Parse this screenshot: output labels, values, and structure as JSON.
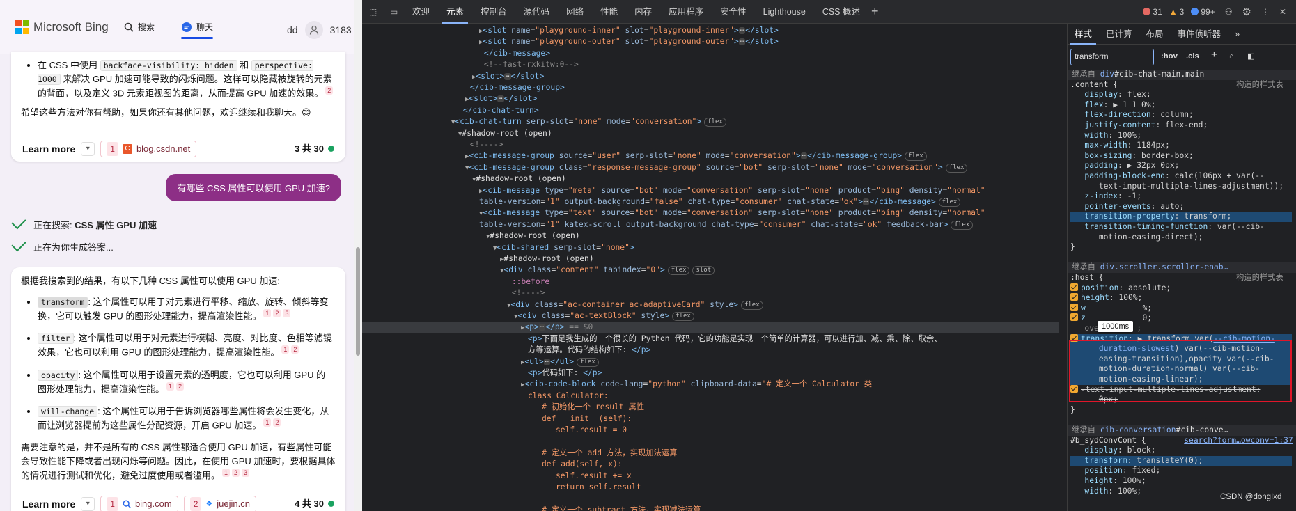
{
  "bing": {
    "brand": "Microsoft Bing",
    "nav": {
      "search": "搜索",
      "chat": "聊天"
    },
    "user": {
      "name": "dd",
      "points": "3183"
    },
    "card1": {
      "li_pre": "在 CSS 中使用",
      "code1": "backface-visibility: hidden",
      "and": "和",
      "code2": "perspective: 1000",
      "li_post": "来解决 GPU 加速可能导致的闪烁问题。这样可以隐藏被旋转的元素的背面，以及定义 3D 元素距视图的距离，从而提高 GPU 加速的效果。",
      "li_cite": "2",
      "closing": "希望这些方法对你有帮助，如果你还有其他问题，欢迎继续和我聊天。😊",
      "learn_more": "Learn more",
      "source1_num": "1",
      "source1": "blog.csdn.net",
      "count": "3 共 30"
    },
    "user_question": "有哪些 CSS 属性可以使用 GPU 加速?",
    "progress1_pre": "正在搜索: ",
    "progress1_bold": "CSS 属性 GPU 加速",
    "progress2": "正在为你生成答案...",
    "card2": {
      "intro": "根据我搜索到的结果，有以下几种 CSS 属性可以使用 GPU 加速:",
      "items": [
        {
          "code": "transform",
          "text": ": 这个属性可以用于对元素进行平移、缩放、旋转、倾斜等变换，它可以触发 GPU 的图形处理能力，提高渲染性能。",
          "cites": [
            "1",
            "2",
            "3"
          ]
        },
        {
          "code": "filter",
          "text": ": 这个属性可以用于对元素进行模糊、亮度、对比度、色相等滤镜效果，它也可以利用 GPU 的图形处理能力，提高渲染性能。",
          "cites": [
            "1",
            "2"
          ]
        },
        {
          "code": "opacity",
          "text": ": 这个属性可以用于设置元素的透明度，它也可以利用 GPU 的图形处理能力，提高渲染性能。",
          "cites": [
            "1",
            "2"
          ]
        },
        {
          "code": "will-change",
          "text": ": 这个属性可以用于告诉浏览器哪些属性将会发生变化，从而让浏览器提前为这些属性分配资源，开启 GPU 加速。",
          "cites": [
            "1",
            "2"
          ]
        }
      ],
      "note": "需要注意的是，并不是所有的 CSS 属性都适合使用 GPU 加速，有些属性可能会导致性能下降或者出现闪烁等问题。因此，在使用 GPU 加速时，要根据具体的情况进行测试和优化，避免过度使用或者滥用。",
      "note_cites": [
        "1",
        "2",
        "3"
      ],
      "learn_more": "Learn more",
      "source1_num": "1",
      "source1": "bing.com",
      "source2_num": "2",
      "source2": "juejin.cn",
      "count": "4 共 30"
    }
  },
  "devtools": {
    "tabs": [
      "欢迎",
      "元素",
      "控制台",
      "源代码",
      "网络",
      "性能",
      "内存",
      "应用程序",
      "安全性",
      "Lighthouse",
      "CSS 概述"
    ],
    "errors": "31",
    "warnings": "3",
    "info": "99+",
    "elements": [
      {
        "i": 0,
        "h": "<span class=\"ar\">▶</span><span class=\"tg\">&lt;slot</span> <span class=\"at\">name</span>=<span class=\"av\">\"playground-inner\"</span> <span class=\"at\">slot</span>=<span class=\"av\">\"playground-inner\"</span><span class=\"tg\">&gt;</span><span class=\"dots\">⋯</span><span class=\"tg\">&lt;/slot&gt;</span>"
      },
      {
        "i": 0,
        "h": "<span class=\"ar\">▶</span><span class=\"tg\">&lt;slot</span> <span class=\"at\">name</span>=<span class=\"av\">\"playground-outer\"</span> <span class=\"at\">slot</span>=<span class=\"av\">\"playground-outer\"</span><span class=\"tg\">&gt;</span><span class=\"dots\">⋯</span><span class=\"tg\">&lt;/slot&gt;</span>"
      },
      {
        "i": 0,
        "h": " <span class=\"tg\">&lt;/cib-message&gt;</span>"
      },
      {
        "i": 0,
        "h": " <span class=\"cm\">&lt;!--fast-rxkitw:0--&gt;</span>"
      },
      {
        "i": -1,
        "h": "<span class=\"ar\">▶</span><span class=\"tg\">&lt;slot&gt;</span><span class=\"dots\">⋯</span><span class=\"tg\">&lt;/slot&gt;</span>"
      },
      {
        "i": -2,
        "h": " <span class=\"tg\">&lt;/cib-message-group&gt;</span>"
      },
      {
        "i": -2,
        "h": "<span class=\"ar\">▶</span><span class=\"tg\">&lt;slot&gt;</span><span class=\"dots\">⋯</span><span class=\"tg\">&lt;/slot&gt;</span>"
      },
      {
        "i": -3,
        "h": " <span class=\"tg\">&lt;/cib-chat-turn&gt;</span>"
      },
      {
        "i": -4,
        "h": "<span class=\"ar\">▼</span><span class=\"tg\">&lt;cib-chat-turn</span> <span class=\"at\">serp-slot</span>=<span class=\"av\">\"none\"</span> <span class=\"at\">mode</span>=<span class=\"av\">\"conversation\"</span><span class=\"tg\">&gt;</span><span class=\"pill\">flex</span>"
      },
      {
        "i": -3,
        "h": "<span class=\"ar\">▼</span><span class=\"tx\">#shadow-root (open)</span>"
      },
      {
        "i": -2,
        "h": " <span class=\"cm\">&lt;!----&gt;</span>"
      },
      {
        "i": -2,
        "h": "<span class=\"ar\">▶</span><span class=\"tg\">&lt;cib-message-group</span> <span class=\"at\">source</span>=<span class=\"av\">\"user\"</span> <span class=\"at\">serp-slot</span>=<span class=\"av\">\"none\"</span> <span class=\"at\">mode</span>=<span class=\"av\">\"conversation\"</span><span class=\"tg\">&gt;</span><span class=\"dots\">⋯</span><span class=\"tg\">&lt;/cib-message-group&gt;</span><span class=\"pill\">flex</span>"
      },
      {
        "i": -2,
        "h": "<span class=\"ar\">▼</span><span class=\"tg\">&lt;cib-message-group</span> <span class=\"at\">class</span>=<span class=\"av\">\"response-message-group\"</span> <span class=\"at\">source</span>=<span class=\"av\">\"bot\"</span> <span class=\"at\">serp-slot</span>=<span class=\"av\">\"none\"</span> <span class=\"at\">mode</span>=<span class=\"av\">\"conversation\"</span><span class=\"tg\">&gt;</span><span class=\"pill\">flex</span>"
      },
      {
        "i": -1,
        "h": "<span class=\"ar\">▼</span><span class=\"tx\">#shadow-root (open)</span>"
      },
      {
        "i": 0,
        "h": "<span class=\"ar\">▶</span><span class=\"tg\">&lt;cib-message</span> <span class=\"at\">type</span>=<span class=\"av\">\"meta\"</span> <span class=\"at\">source</span>=<span class=\"av\">\"bot\"</span> <span class=\"at\">mode</span>=<span class=\"av\">\"conversation\"</span> <span class=\"at\">serp-slot</span>=<span class=\"av\">\"none\"</span> <span class=\"at\">product</span>=<span class=\"av\">\"bing\"</span> <span class=\"at\">density</span>=<span class=\"av\">\"normal\"</span>"
      },
      {
        "i": 0,
        "h": "<span class=\"at\">table-version</span>=<span class=\"av\">\"1\"</span> <span class=\"at\">output-background</span>=<span class=\"av\">\"false\"</span> <span class=\"at\">chat-type</span>=<span class=\"av\">\"consumer\"</span> <span class=\"at\">chat-state</span>=<span class=\"av\">\"ok\"</span><span class=\"tg\">&gt;</span><span class=\"dots\">⋯</span><span class=\"tg\">&lt;/cib-message&gt;</span><span class=\"pill\">flex</span>"
      },
      {
        "i": 0,
        "h": "<span class=\"ar\">▼</span><span class=\"tg\">&lt;cib-message</span> <span class=\"at\">type</span>=<span class=\"av\">\"text\"</span> <span class=\"at\">source</span>=<span class=\"av\">\"bot\"</span> <span class=\"at\">mode</span>=<span class=\"av\">\"conversation\"</span> <span class=\"at\">serp-slot</span>=<span class=\"av\">\"none\"</span> <span class=\"at\">product</span>=<span class=\"av\">\"bing\"</span> <span class=\"at\">density</span>=<span class=\"av\">\"normal\"</span>"
      },
      {
        "i": 0,
        "h": "<span class=\"at\">table-version</span>=<span class=\"av\">\"1\"</span> <span class=\"at\">katex-scroll</span> <span class=\"at\">output-background</span> <span class=\"at\">chat-type</span>=<span class=\"av\">\"consumer\"</span> <span class=\"at\">chat-state</span>=<span class=\"av\">\"ok\"</span> <span class=\"at\">feedback-bar</span><span class=\"tg\">&gt;</span><span class=\"pill\">flex</span>"
      },
      {
        "i": 1,
        "h": "<span class=\"ar\">▼</span><span class=\"tx\">#shadow-root (open)</span>"
      },
      {
        "i": 2,
        "h": "<span class=\"ar\">▼</span><span class=\"tg\">&lt;cib-shared</span> <span class=\"at\">serp-slot</span>=<span class=\"av\">\"none\"</span><span class=\"tg\">&gt;</span>"
      },
      {
        "i": 3,
        "h": "<span class=\"ar\">▶</span><span class=\"tx\">#shadow-root (open)</span>"
      },
      {
        "i": 3,
        "h": "<span class=\"ar\">▼</span><span class=\"tg\">&lt;div</span> <span class=\"at\">class</span>=<span class=\"av\">\"content\"</span> <span class=\"at\">tabindex</span>=<span class=\"av\">\"0\"</span><span class=\"tg\">&gt;</span><span class=\"pill\">flex</span><span class=\"pill\">slot</span>"
      },
      {
        "i": 4,
        "h": " <span class=\"pe\">::before</span>"
      },
      {
        "i": 4,
        "h": " <span class=\"cm\">&lt;!----&gt;</span>"
      },
      {
        "i": 4,
        "h": "<span class=\"ar\">▼</span><span class=\"tg\">&lt;div</span> <span class=\"at\">class</span>=<span class=\"av\">\"ac-container ac-adaptiveCard\"</span> <span class=\"at\">style</span><span class=\"tg\">&gt;</span><span class=\"pill\">flex</span>"
      },
      {
        "i": 5,
        "h": "<span class=\"ar\">▼</span><span class=\"tg\">&lt;div</span> <span class=\"at\">class</span>=<span class=\"av\">\"ac-textBlock\"</span> <span class=\"at\">style</span><span class=\"tg\">&gt;</span><span class=\"pill\">flex</span>"
      },
      {
        "i": 6,
        "sel": true,
        "h": "<span class=\"ar\">▶</span><span class=\"tg\">&lt;p&gt;</span><span class=\"dots\">⋯</span><span class=\"tg\">&lt;/p&gt;</span> <span class=\"cm\">== $0</span>"
      },
      {
        "i": 7,
        "h": "<span class=\"tg\">&lt;p&gt;</span><span class=\"tx\">下面是我生成的一个很长的 Python 代码，它的功能是实现一个简单的计算器，可以进行加、减、乘、除、取余、</span>"
      },
      {
        "i": 7,
        "h": "<span class=\"tx\">方等运算。代码的结构如下: </span><span class=\"tg\">&lt;/p&gt;</span>"
      },
      {
        "i": 6,
        "h": "<span class=\"ar\">▶</span><span class=\"tg\">&lt;ul&gt;</span><span class=\"dots\">⋯</span><span class=\"tg\">&lt;/ul&gt;</span><span class=\"pill\">flex</span>"
      },
      {
        "i": 7,
        "h": "<span class=\"tg\">&lt;p&gt;</span><span class=\"tx\">代码如下: </span><span class=\"tg\">&lt;/p&gt;</span>"
      },
      {
        "i": 6,
        "h": "<span class=\"ar\">▶</span><span class=\"tg\">&lt;cib-code-block</span> <span class=\"at\">code-lang</span>=<span class=\"av\">\"python\"</span> <span class=\"at\">clipboard-data</span>=<span class=\"av\">\"# 定义一个 Calculator 类</span>"
      },
      {
        "i": 7,
        "h": "<span class=\"av\">class Calculator:</span>"
      },
      {
        "i": 9,
        "h": "<span class=\"av\"># 初始化一个 result 属性</span>"
      },
      {
        "i": 9,
        "h": "<span class=\"av\">def __init__(self):</span>"
      },
      {
        "i": 11,
        "h": "<span class=\"av\">self.result = 0</span>"
      },
      {
        "i": 9,
        "h": " "
      },
      {
        "i": 9,
        "h": "<span class=\"av\"># 定义一个 add 方法，实现加法运算</span>"
      },
      {
        "i": 9,
        "h": "<span class=\"av\">def add(self, x):</span>"
      },
      {
        "i": 11,
        "h": "<span class=\"av\">self.result += x</span>"
      },
      {
        "i": 11,
        "h": "<span class=\"av\">return self.result</span>"
      },
      {
        "i": 9,
        "h": " "
      },
      {
        "i": 9,
        "h": "<span class=\"av\"># 定义一个 subtract 方法，实现减法运算</span>"
      }
    ],
    "styles_tabs": [
      "样式",
      "已计算",
      "布局",
      "事件侦听器"
    ],
    "filter_value": "transform",
    "hov": ":hov",
    "cls": ".cls",
    "tooltip": "1000ms",
    "watermark": "CSDN @dongIxd",
    "styles_lines": [
      {
        "t": 1,
        "h": "<span class=\"gray\">继承自 </span><span class=\"lnk\" style=\"text-decoration:none\">div</span><span class=\"sel\">#cib-chat-main.main</span>"
      },
      {
        "t": 0,
        "h": "<span class=\"sel\">.content {</span>                         <span class=\"gray\">构造的样式表</span>"
      },
      {
        "t": 0,
        "h": "   <span class=\"pn\">display</span>: <span class=\"pv\">flex;</span>"
      },
      {
        "t": 0,
        "h": "   <span class=\"pn\">flex</span>: <span class=\"pv\">▶ 1 1 0%;</span>"
      },
      {
        "t": 0,
        "h": "   <span class=\"pn\">flex-direction</span>: <span class=\"pv\">column;</span>"
      },
      {
        "t": 0,
        "h": "   <span class=\"pn\">justify-content</span>: <span class=\"pv\">flex-end;</span>"
      },
      {
        "t": 0,
        "h": "   <span class=\"pn\">width</span>: <span class=\"pv\">100%;</span>"
      },
      {
        "t": 0,
        "h": "   <span class=\"pn\">max-width</span>: <span class=\"pv\">1184px;</span>"
      },
      {
        "t": 0,
        "h": "   <span class=\"pn\">box-sizing</span>: <span class=\"pv\">border-box;</span>"
      },
      {
        "t": 0,
        "h": "   <span class=\"pn\">padding</span>: <span class=\"pv\">▶ 32px 0px;</span>"
      },
      {
        "t": 0,
        "h": "   <span class=\"pn\">padding-block-end</span>: <span class=\"pv\">calc(106px + var(--</span>"
      },
      {
        "t": 0,
        "h": "      <span class=\"pv\">text-input-multiple-lines-adjustment));</span>"
      },
      {
        "t": 0,
        "h": "   <span class=\"pn\">z-index</span>: <span class=\"pv\">-1;</span>"
      },
      {
        "t": 0,
        "h": "   <span class=\"pn\">pointer-events</span>: <span class=\"pv\">auto;</span>"
      },
      {
        "t": 2,
        "h": "   <span class=\"pn\">transition-property</span>: <span class=\"pv\">transform;</span>"
      },
      {
        "t": 0,
        "h": "   <span class=\"pn\">transition-timing-function</span>: <span class=\"pv\">var(--cib-</span>"
      },
      {
        "t": 0,
        "h": "      <span class=\"pv\">motion-easing-direct);</span>"
      },
      {
        "t": 0,
        "h": "<span class=\"sel\">}</span>"
      },
      {
        "t": 0,
        "h": " "
      },
      {
        "t": 1,
        "h": "<span class=\"gray\">继承自 </span><span class=\"lnk\" style=\"text-decoration:none\">div.scroller.scroller-enab…</span>"
      },
      {
        "t": 0,
        "h": "<span class=\"sel\">:host {</span>                            <span class=\"gray\">构造的样式表</span>"
      },
      {
        "t": 0,
        "h": "<span class=\"cb\"></span><span class=\"pn\">position</span>: <span class=\"pv\">absolute;</span>"
      },
      {
        "t": 0,
        "h": "<span class=\"cb\"></span><span class=\"pn\">height</span>: <span class=\"pv\">100%;</span>"
      },
      {
        "t": 0,
        "h": "<span class=\"cb\"></span><span class=\"pn\">w</span>            <span class=\"pv\">%;</span>"
      },
      {
        "t": 0,
        "h": "<span class=\"cb\"></span><span class=\"pn\">z</span>            <span class=\"pv\">0;</span>"
      },
      {
        "t": 0,
        "h": "   <span class=\"gray\">over-ste.. ;</span>"
      },
      {
        "t": 2,
        "h": "<span class=\"cb\"></span><span class=\"pn\">transition</span>: <span class=\"pv\">▶ transform var(</span><span class=\"lnk\">--cib-motion-</span>"
      },
      {
        "t": 2,
        "h": "      <span class=\"lnk\">duration-slowest</span><span class=\"pv\">) var(--cib-motion-</span>"
      },
      {
        "t": 2,
        "h": "      <span class=\"pv\">easing-transition),opacity var(--cib-</span>"
      },
      {
        "t": 2,
        "h": "      <span class=\"pv\">motion-duration-normal) var(--cib-</span>"
      },
      {
        "t": 2,
        "h": "      <span class=\"pv\">motion-easing-linear);</span>"
      },
      {
        "t": 0,
        "h": "<span class=\"cb\"></span><span class=\"pv\" style=\"text-decoration:line-through\">-text-input-multiple-lines-adjustment:</span>"
      },
      {
        "t": 0,
        "h": "      <span class=\"pv\" style=\"text-decoration:line-through\">0px;</span>"
      },
      {
        "t": 0,
        "h": "<span class=\"sel\">}</span>"
      },
      {
        "t": 0,
        "h": " "
      },
      {
        "t": 1,
        "h": "<span class=\"gray\">继承自 </span><span class=\"lnk\" style=\"text-decoration:none\">cib-conversation</span><span class=\"sel\">#cib-conve…</span>"
      },
      {
        "t": 0,
        "h": "<span class=\"sel\">#b_sydConvCont {</span>        <span class=\"lnk\">search?form…owconv=1:37</span>"
      },
      {
        "t": 0,
        "h": "   <span class=\"pn\">display</span>: <span class=\"pv\">block;</span>"
      },
      {
        "t": 2,
        "h": "   <span class=\"pn\">transform</span>: <span class=\"pv\">translateY(0);</span>"
      },
      {
        "t": 0,
        "h": "   <span class=\"pn\">position</span>: <span class=\"pv\">fixed;</span>"
      },
      {
        "t": 0,
        "h": "   <span class=\"pn\">height</span>: <span class=\"pv\">100%;</span>"
      },
      {
        "t": 0,
        "h": "   <span class=\"pn\">width</span>: <span class=\"pv\">100%;</span>"
      }
    ]
  }
}
